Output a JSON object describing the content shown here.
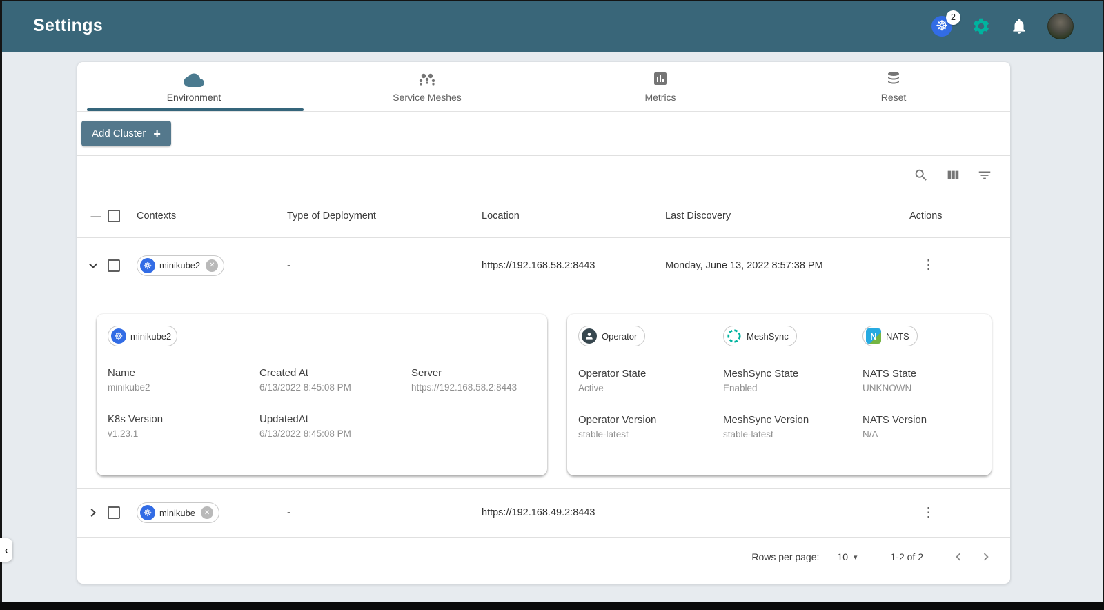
{
  "colors": {
    "header_bg": "#396679",
    "accent_green": "#00B39F",
    "kubernetes_blue": "#326CE5",
    "button_bg": "#54788c",
    "tab_indicator": "#35657b",
    "nats_blue": "#27AAE1",
    "nats_green": "#8DC63F"
  },
  "icons": {
    "helm": "☸",
    "kebab": "⋮",
    "close": "✕",
    "plus": "+",
    "caret": "▾",
    "minus": "—",
    "handle_chevron": "‹",
    "nats_letter": "N"
  },
  "header": {
    "title": "Settings",
    "k8s_badge": "2"
  },
  "tabs": {
    "items": [
      {
        "label": "Environment",
        "active": true
      },
      {
        "label": "Service Meshes",
        "active": false
      },
      {
        "label": "Metrics",
        "active": false
      },
      {
        "label": "Reset",
        "active": false
      }
    ]
  },
  "add_cluster": {
    "label": "Add Cluster"
  },
  "table": {
    "headers": [
      "Contexts",
      "Type of Deployment",
      "Location",
      "Last Discovery",
      "Actions"
    ],
    "rows": [
      {
        "context": "minikube2",
        "type_of_deployment": "-",
        "location": "https://192.168.58.2:8443",
        "last_discovery": "Monday, June 13, 2022 8:57:38 PM",
        "expanded": true
      },
      {
        "context": "minikube",
        "type_of_deployment": "-",
        "location": "https://192.168.49.2:8443",
        "last_discovery": "",
        "expanded": false
      }
    ]
  },
  "details": {
    "cluster_chip": "minikube2",
    "left": [
      {
        "label": "Name",
        "value": "minikube2"
      },
      {
        "label": "Created At",
        "value": "6/13/2022 8:45:08 PM"
      },
      {
        "label": "Server",
        "value": "https://192.168.58.2:8443"
      },
      {
        "label": "K8s Version",
        "value": "v1.23.1"
      },
      {
        "label": "UpdatedAt",
        "value": "6/13/2022 8:45:08 PM"
      }
    ],
    "chips": [
      "Operator",
      "MeshSync",
      "NATS"
    ],
    "right": [
      {
        "label": "Operator State",
        "value": "Active"
      },
      {
        "label": "MeshSync State",
        "value": "Enabled"
      },
      {
        "label": "NATS State",
        "value": "UNKNOWN"
      },
      {
        "label": "Operator Version",
        "value": "stable-latest"
      },
      {
        "label": "MeshSync Version",
        "value": "stable-latest"
      },
      {
        "label": "NATS Version",
        "value": "N/A"
      }
    ]
  },
  "pagination": {
    "rows_per_page_label": "Rows per page:",
    "rows_per_page_value": "10",
    "range_label": "1-2 of 2"
  }
}
